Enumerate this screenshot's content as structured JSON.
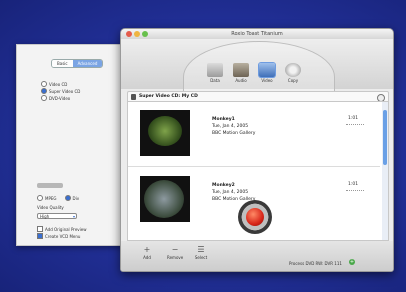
{
  "prefs": {
    "tabs": [
      "Basic",
      "Advanced"
    ],
    "selected_tab": "Advanced",
    "format_options": [
      {
        "label": "Video CD",
        "selected": false
      },
      {
        "label": "Super Video CD",
        "selected": true
      },
      {
        "label": "DVD-Video",
        "selected": false
      }
    ],
    "encoder_options": [
      {
        "label": "MPEG",
        "selected": false
      },
      {
        "label": "Div",
        "selected": true
      }
    ],
    "video_quality_label": "Video Quality",
    "video_quality_value": "High",
    "checkboxes": [
      {
        "label": "Add Original Preview",
        "checked": false
      },
      {
        "label": "Create VCD Menu",
        "checked": true
      }
    ]
  },
  "window": {
    "title": "Roxio Toast Titanium",
    "toolbar_tabs": [
      {
        "label": "Data",
        "icon": "data-icon",
        "selected": false
      },
      {
        "label": "Audio",
        "icon": "audio-icon",
        "selected": false
      },
      {
        "label": "Video",
        "icon": "video-icon",
        "selected": true
      },
      {
        "label": "Copy",
        "icon": "copy-icon",
        "selected": false
      }
    ],
    "breadcrumb": "Super Video CD: My CD",
    "items": [
      {
        "name": "Monkey1",
        "date": "Tue, Jan 4, 2005",
        "source": "BBC Motion Gallery",
        "duration": "1:01"
      },
      {
        "name": "Monkey2",
        "date": "Tue, Jan 4, 2005",
        "source": "BBC Motion Gallery",
        "duration": "1:01"
      }
    ],
    "bottom_buttons": [
      "Add",
      "Remove",
      "Select"
    ],
    "status": "Process DVD RW: DVR 111"
  },
  "colors": {
    "accent": "#3a6fd0",
    "background": "#1d2a8c",
    "burn_button": "#d8261a"
  }
}
